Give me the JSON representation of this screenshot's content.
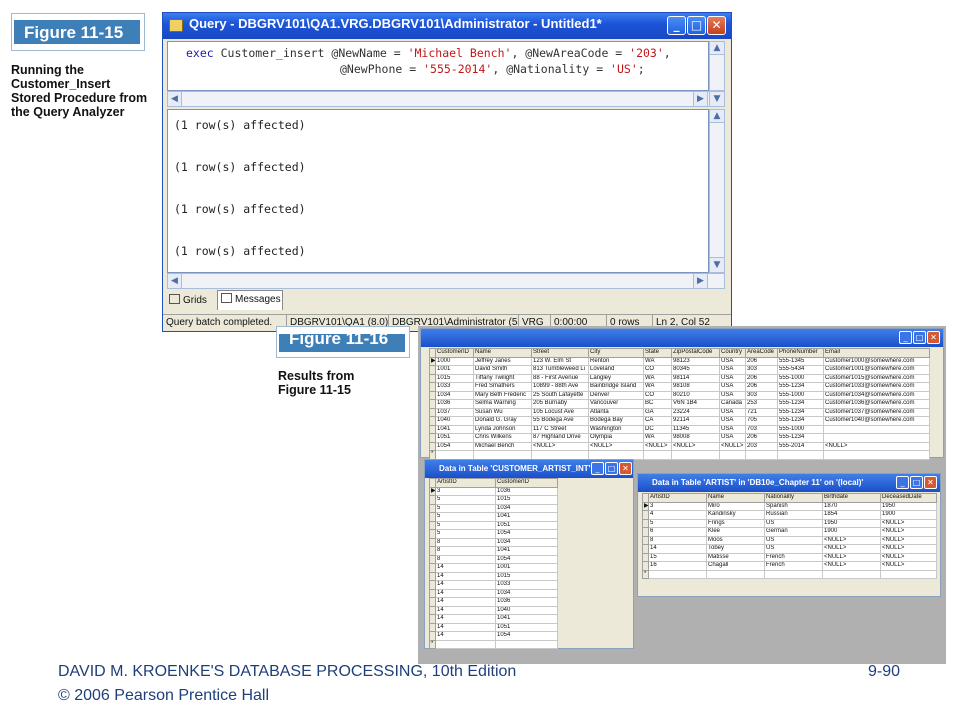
{
  "figure_top": {
    "label": "Figure 11-15",
    "caption": "Running the\nCustomer_Insert\nStored Procedure from\nthe Query Analyzer"
  },
  "figure_bottom": {
    "label": "Figure 11-16",
    "caption": "Results from\nFigure 11-15"
  },
  "query_window": {
    "title": "Query - DBGRV101\\QA1.VRG.DBGRV101\\Administrator - Untitled1*",
    "code": {
      "l1_kw": "exec",
      "l1_a": " Customer_insert @NewName = ",
      "l1_s1": "'Michael Bench'",
      "l1_b": ", @NewAreaCode = ",
      "l1_s2": "'203'",
      "l1_c": ",",
      "l2_a": "@NewPhone = ",
      "l2_s1": "'555-2014'",
      "l2_b": ", @Nationality = ",
      "l2_s2": "'US'",
      "l2_c": ";"
    },
    "messages": [
      "(1 row(s) affected)",
      "(1 row(s) affected)",
      "(1 row(s) affected)",
      "(1 row(s) affected)"
    ],
    "tabs": {
      "grids": "Grids",
      "messages": "Messages"
    },
    "status": [
      "Query batch completed.",
      "DBGRV101\\QA1 (8.0)",
      "DBGRV101\\Administrator (53)",
      "VRG",
      "0:00:00",
      "0 rows",
      "Ln 2, Col 52"
    ]
  },
  "customer_grid": {
    "headers": [
      "CustomerID",
      "Name",
      "Street",
      "City",
      "State",
      "ZipPostalCode",
      "Country",
      "AreaCode",
      "PhoneNumber",
      "Email"
    ],
    "rows": [
      [
        "1000",
        "Jeffrey Janes",
        "123 W. Elm St",
        "Renton",
        "WA",
        "98123",
        "USA",
        "206",
        "555-1345",
        "Customer1000@somewhere.com"
      ],
      [
        "1001",
        "David Smith",
        "813 Tumbleweed Li",
        "Loveland",
        "CO",
        "80345",
        "USA",
        "303",
        "555-5434",
        "Customer1001@somewhere.com"
      ],
      [
        "1015",
        "Tiffany Twilight",
        "88 - First Avenue",
        "Langley",
        "WA",
        "98114",
        "USA",
        "206",
        "555-1000",
        "Customer1015@somewhere.com"
      ],
      [
        "1033",
        "Fred Smathers",
        "10899 - 88th Ave",
        "Bainbridge Island",
        "WA",
        "98108",
        "USA",
        "206",
        "555-1234",
        "Customer1033@somewhere.com"
      ],
      [
        "1034",
        "Mary Beth Frederic",
        "25 South Lafayette",
        "Denver",
        "CO",
        "80210",
        "USA",
        "303",
        "555-1000",
        "Customer1034@somewhere.com"
      ],
      [
        "1036",
        "Selma Warning",
        "205 Burnaby",
        "Vancouver",
        "BC",
        "V6N 1B4",
        "Canada",
        "253",
        "555-1234",
        "Customer1036@somewhere.com"
      ],
      [
        "1037",
        "Susan Wu",
        "105 Locust Ave",
        "Atlanta",
        "GA",
        "23224",
        "USA",
        "721",
        "555-1234",
        "Customer1037@somewhere.com"
      ],
      [
        "1040",
        "Donald G. Gray",
        "55 Bodega Ave",
        "Bodega Bay",
        "CA",
        "92114",
        "USA",
        "705",
        "555-1234",
        "Customer1040@somewhere.com"
      ],
      [
        "1041",
        "Lynda Johnson",
        "117 C Street",
        "Washington",
        "DC",
        "11345",
        "USA",
        "703",
        "555-1000",
        ""
      ],
      [
        "1051",
        "Chris Wilkens",
        "87 Highland Drive",
        "Olympia",
        "WA",
        "98008",
        "USA",
        "206",
        "555-1234",
        ""
      ],
      [
        "1054",
        "Michael Bench",
        "<NULL>",
        "<NULL>",
        "<NULL>",
        "<NULL>",
        "<NULL>",
        "203",
        "555-2014",
        "<NULL>"
      ]
    ]
  },
  "ca_grid": {
    "title": "Data in Table 'CUSTOMER_ARTIST_INT'...",
    "headers": [
      "ArtistID",
      "CustomerID"
    ],
    "rows": [
      [
        "3",
        "1036"
      ],
      [
        "5",
        "1015"
      ],
      [
        "5",
        "1034"
      ],
      [
        "5",
        "1041"
      ],
      [
        "5",
        "1051"
      ],
      [
        "5",
        "1054"
      ],
      [
        "8",
        "1034"
      ],
      [
        "8",
        "1041"
      ],
      [
        "8",
        "1054"
      ],
      [
        "14",
        "1001"
      ],
      [
        "14",
        "1015"
      ],
      [
        "14",
        "1033"
      ],
      [
        "14",
        "1034"
      ],
      [
        "14",
        "1036"
      ],
      [
        "14",
        "1040"
      ],
      [
        "14",
        "1041"
      ],
      [
        "14",
        "1051"
      ],
      [
        "14",
        "1054"
      ]
    ]
  },
  "artist_grid": {
    "title": "Data in Table 'ARTIST' in 'DB10e_Chapter 11' on '(local)'",
    "headers": [
      "ArtistID",
      "Name",
      "Nationality",
      "Birthdate",
      "DeceasedDate"
    ],
    "rows": [
      [
        "3",
        "Miro",
        "Spanish",
        "1870",
        "1950"
      ],
      [
        "4",
        "Kandinsky",
        "Russian",
        "1854",
        "1900"
      ],
      [
        "5",
        "Frings",
        "US",
        "1950",
        "<NULL>"
      ],
      [
        "6",
        "Klee",
        "German",
        "1900",
        "<NULL>"
      ],
      [
        "8",
        "Moos",
        "US",
        "<NULL>",
        "<NULL>"
      ],
      [
        "14",
        "Tobey",
        "US",
        "<NULL>",
        "<NULL>"
      ],
      [
        "15",
        "Matisse",
        "French",
        "<NULL>",
        "<NULL>"
      ],
      [
        "16",
        "Chagall",
        "French",
        "<NULL>",
        "<NULL>"
      ]
    ]
  },
  "footer": {
    "line1": "DAVID M. KROENKE'S DATABASE PROCESSING, 10th Edition",
    "line2": "© 2006 Pearson Prentice Hall",
    "page": "9-90"
  }
}
